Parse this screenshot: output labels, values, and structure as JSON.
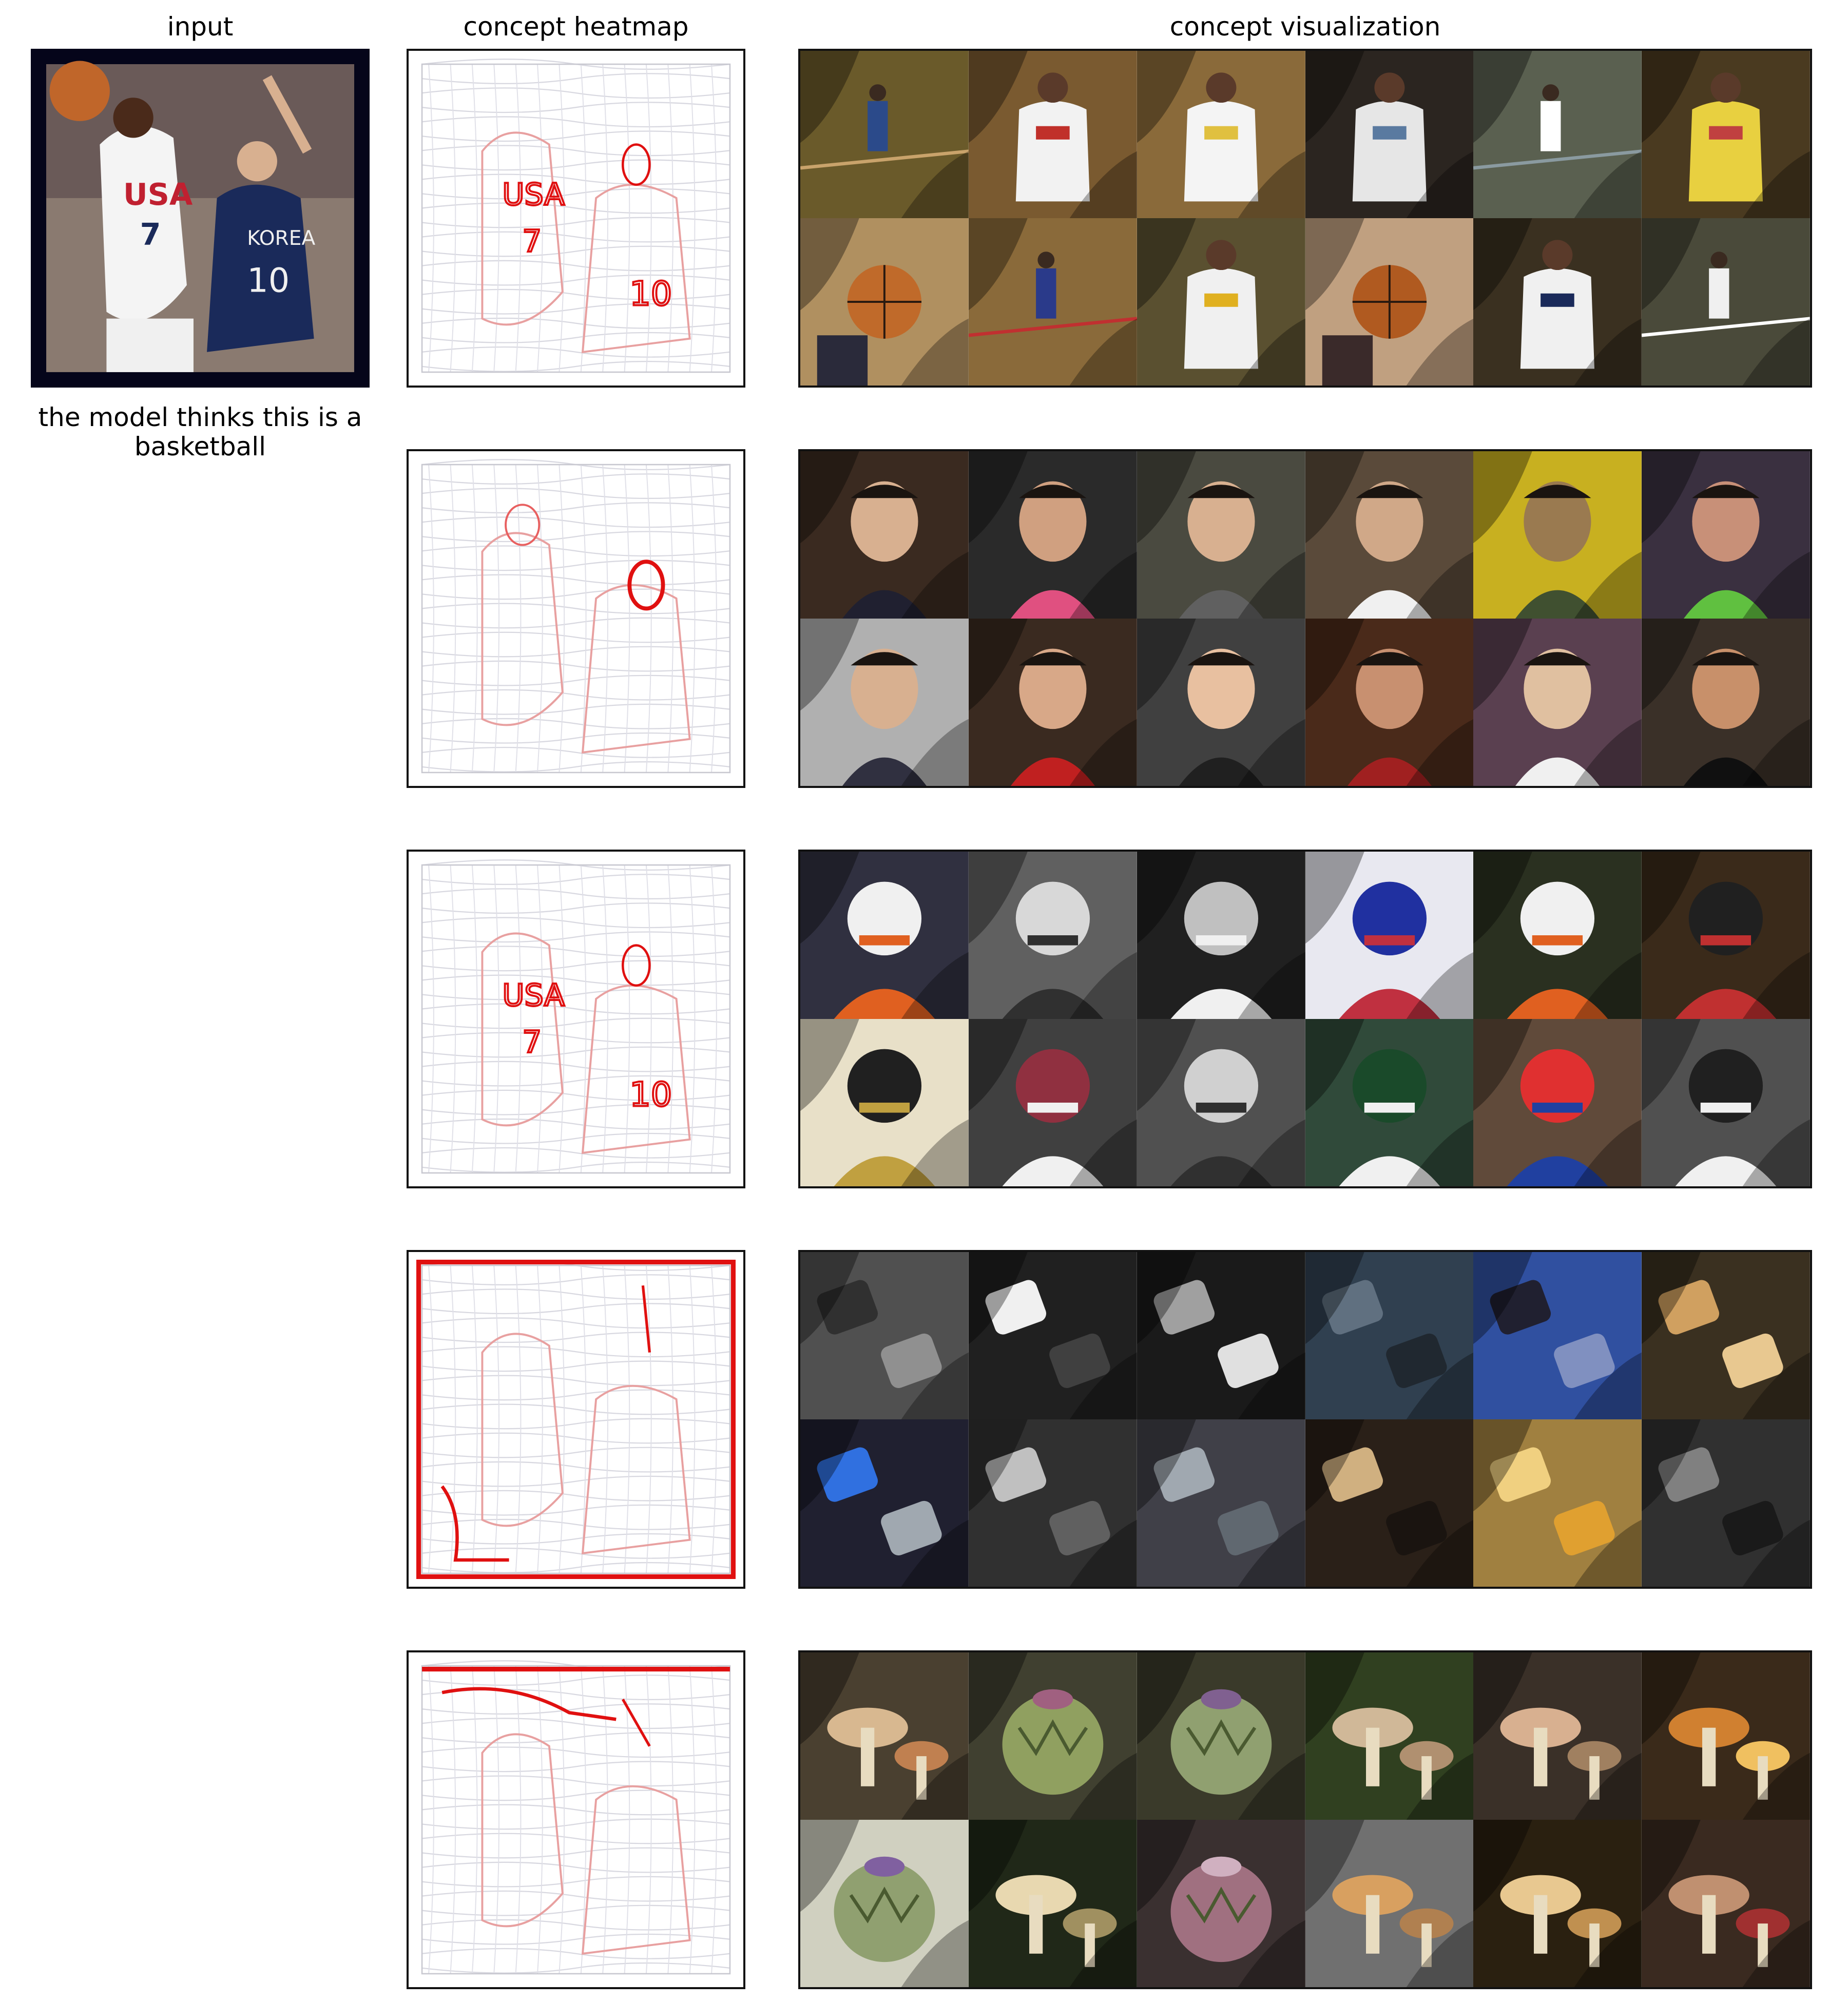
{
  "headers": {
    "input": "input",
    "heatmap": "concept heatmap",
    "visualization": "concept visualization"
  },
  "prediction_caption": "the model thinks this is a basketball",
  "input_image": {
    "description_icon": "basketball-players-photo",
    "jersey_left": {
      "team": "USA",
      "number": "7"
    },
    "jersey_right": {
      "team": "KOREA",
      "number": "10"
    }
  },
  "concepts": [
    {
      "id": "concept-1",
      "heatmap_focus": "jerseys",
      "tiles": [
        {
          "theme": "court",
          "bg": "#6a5a2a",
          "fg": "#2b4a8a",
          "accent": "#c9a36b"
        },
        {
          "theme": "player",
          "bg": "#7a5a30",
          "fg": "#f2f2f2",
          "accent": "#c0302a"
        },
        {
          "theme": "player",
          "bg": "#8a6a3a",
          "fg": "#f4f4f4",
          "accent": "#e0c040"
        },
        {
          "theme": "player",
          "bg": "#2b2520",
          "fg": "#e6e6e6",
          "accent": "#5a7aa0"
        },
        {
          "theme": "court",
          "bg": "#5a6050",
          "fg": "#ffffff",
          "accent": "#8a9aa0"
        },
        {
          "theme": "player",
          "bg": "#4a3a20",
          "fg": "#e8d040",
          "accent": "#c04040"
        },
        {
          "theme": "ball",
          "bg": "#b09060",
          "fg": "#c06a2a",
          "accent": "#2a2a3a"
        },
        {
          "theme": "court",
          "bg": "#8a6a3a",
          "fg": "#2a3a8a",
          "accent": "#c03030"
        },
        {
          "theme": "player",
          "bg": "#5a5030",
          "fg": "#f0f0f0",
          "accent": "#e0b020"
        },
        {
          "theme": "ball",
          "bg": "#c0a080",
          "fg": "#b05a20",
          "accent": "#3a2a2a"
        },
        {
          "theme": "player",
          "bg": "#3a3020",
          "fg": "#f0f0f0",
          "accent": "#1a2a5a"
        },
        {
          "theme": "court",
          "bg": "#4a4a3a",
          "fg": "#f0f0f0",
          "accent": "#ffffff"
        }
      ]
    },
    {
      "id": "concept-2",
      "heatmap_focus": "faces",
      "tiles": [
        {
          "theme": "face",
          "bg": "#3a2a20",
          "fg": "#d8b090",
          "accent": "#202030"
        },
        {
          "theme": "face",
          "bg": "#2a2a2a",
          "fg": "#d0a080",
          "accent": "#e05080"
        },
        {
          "theme": "face",
          "bg": "#4a4a40",
          "fg": "#d8b090",
          "accent": "#606060"
        },
        {
          "theme": "face",
          "bg": "#5a4a3a",
          "fg": "#d0a888",
          "accent": "#f0f0f0"
        },
        {
          "theme": "face",
          "bg": "#c8b020",
          "fg": "#9a7a50",
          "accent": "#405030"
        },
        {
          "theme": "face",
          "bg": "#3a3040",
          "fg": "#c89078",
          "accent": "#60c040"
        },
        {
          "theme": "face",
          "bg": "#b0b0b0",
          "fg": "#d8b090",
          "accent": "#303040"
        },
        {
          "theme": "face",
          "bg": "#3a2a20",
          "fg": "#d8a888",
          "accent": "#c02020"
        },
        {
          "theme": "face",
          "bg": "#404040",
          "fg": "#e8c0a0",
          "accent": "#202020"
        },
        {
          "theme": "face",
          "bg": "#4a2a1a",
          "fg": "#c89070",
          "accent": "#a02020"
        },
        {
          "theme": "face",
          "bg": "#5a4050",
          "fg": "#e0c0a0",
          "accent": "#f0f0f0"
        },
        {
          "theme": "face",
          "bg": "#3a3028",
          "fg": "#c8906a",
          "accent": "#101010"
        }
      ]
    },
    {
      "id": "concept-3",
      "heatmap_focus": "numbers",
      "tiles": [
        {
          "theme": "helmet",
          "bg": "#303040",
          "fg": "#f0f0f0",
          "accent": "#e06020"
        },
        {
          "theme": "helmet",
          "bg": "#606060",
          "fg": "#d8d8d8",
          "accent": "#303030"
        },
        {
          "theme": "helmet",
          "bg": "#202020",
          "fg": "#c0c0c0",
          "accent": "#f0f0f0"
        },
        {
          "theme": "helmet",
          "bg": "#e8e8f0",
          "fg": "#2030a0",
          "accent": "#c03040"
        },
        {
          "theme": "helmet",
          "bg": "#2a3020",
          "fg": "#f0f0f0",
          "accent": "#e06020"
        },
        {
          "theme": "helmet",
          "bg": "#3a2a1a",
          "fg": "#202020",
          "accent": "#c03030"
        },
        {
          "theme": "helmet",
          "bg": "#e8e0c8",
          "fg": "#202020",
          "accent": "#c0a040"
        },
        {
          "theme": "helmet",
          "bg": "#404040",
          "fg": "#903040",
          "accent": "#f0f0f0"
        },
        {
          "theme": "helmet",
          "bg": "#505050",
          "fg": "#d0d0d0",
          "accent": "#303030"
        },
        {
          "theme": "helmet",
          "bg": "#304a3a",
          "fg": "#1a4a2a",
          "accent": "#f0f0f0"
        },
        {
          "theme": "helmet",
          "bg": "#604a3a",
          "fg": "#e03030",
          "accent": "#2040a0"
        },
        {
          "theme": "helmet",
          "bg": "#505050",
          "fg": "#202020",
          "accent": "#f0f0f0"
        }
      ]
    },
    {
      "id": "concept-4",
      "heatmap_focus": "edges",
      "tiles": [
        {
          "theme": "keys",
          "bg": "#505050",
          "fg": "#303030",
          "accent": "#909090"
        },
        {
          "theme": "keys",
          "bg": "#202020",
          "fg": "#f0f0f0",
          "accent": "#404040"
        },
        {
          "theme": "keys",
          "bg": "#1a1a1a",
          "fg": "#a0a0a0",
          "accent": "#e0e0e0"
        },
        {
          "theme": "keys",
          "bg": "#304050",
          "fg": "#607080",
          "accent": "#202830"
        },
        {
          "theme": "keys",
          "bg": "#3050a0",
          "fg": "#202030",
          "accent": "#8090c0"
        },
        {
          "theme": "keys",
          "bg": "#3a3020",
          "fg": "#d0a060",
          "accent": "#e8c890"
        },
        {
          "theme": "keys",
          "bg": "#202030",
          "fg": "#3070e0",
          "accent": "#a0a8b0"
        },
        {
          "theme": "keys",
          "bg": "#303030",
          "fg": "#c0c0c0",
          "accent": "#606060"
        },
        {
          "theme": "keys",
          "bg": "#404048",
          "fg": "#a0a8b0",
          "accent": "#606870"
        },
        {
          "theme": "keys",
          "bg": "#2a2018",
          "fg": "#d0b080",
          "accent": "#1a1410"
        },
        {
          "theme": "keys",
          "bg": "#a08040",
          "fg": "#f0d080",
          "accent": "#e0a030"
        },
        {
          "theme": "keys",
          "bg": "#303030",
          "fg": "#808080",
          "accent": "#1a1a1a"
        }
      ]
    },
    {
      "id": "concept-5",
      "heatmap_focus": "top-edge",
      "tiles": [
        {
          "theme": "mushroom",
          "bg": "#4a4030",
          "fg": "#d8b890",
          "accent": "#c08050"
        },
        {
          "theme": "artichoke",
          "bg": "#404030",
          "fg": "#90a060",
          "accent": "#a06080"
        },
        {
          "theme": "artichoke",
          "bg": "#3a3a2a",
          "fg": "#90a070",
          "accent": "#806090"
        },
        {
          "theme": "mushroom",
          "bg": "#304020",
          "fg": "#d0b898",
          "accent": "#b09070"
        },
        {
          "theme": "mushroom",
          "bg": "#3a3028",
          "fg": "#d8b090",
          "accent": "#a08060"
        },
        {
          "theme": "mushroom",
          "bg": "#3a2a1a",
          "fg": "#d08030",
          "accent": "#f0c060"
        },
        {
          "theme": "artichoke",
          "bg": "#d0d0c0",
          "fg": "#90a070",
          "accent": "#8060a0"
        },
        {
          "theme": "mushroom",
          "bg": "#202818",
          "fg": "#e8d8b0",
          "accent": "#a09060"
        },
        {
          "theme": "artichoke",
          "bg": "#3a3030",
          "fg": "#a07080",
          "accent": "#d0b0c0"
        },
        {
          "theme": "mushroom",
          "bg": "#707070",
          "fg": "#d8a060",
          "accent": "#b08050"
        },
        {
          "theme": "mushroom",
          "bg": "#2a2010",
          "fg": "#e8c890",
          "accent": "#c09050"
        },
        {
          "theme": "mushroom",
          "bg": "#3a2a20",
          "fg": "#c09070",
          "accent": "#a03030"
        }
      ]
    }
  ]
}
